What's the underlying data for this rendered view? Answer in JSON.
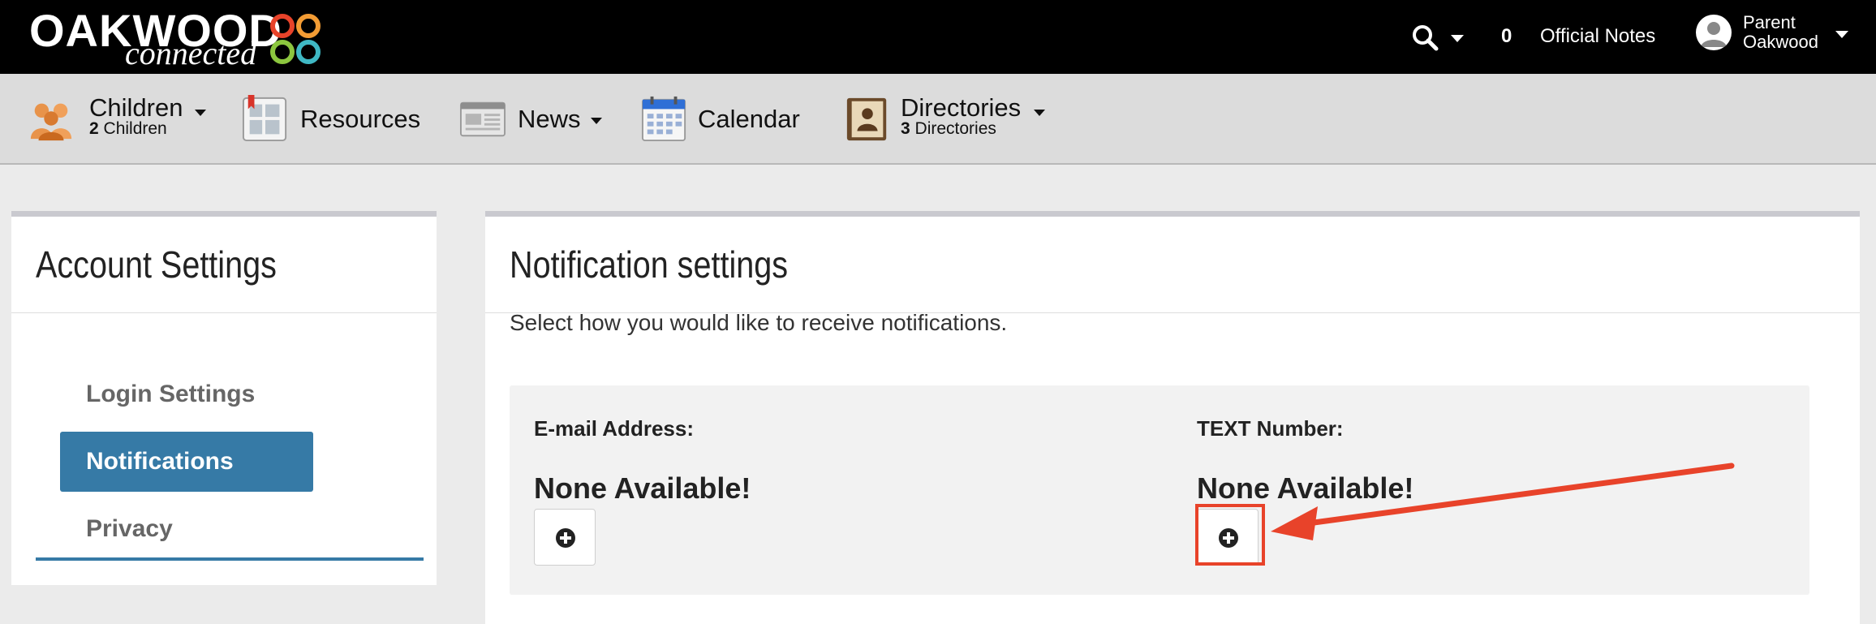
{
  "topbar": {
    "logo_main": "OAKWOOD",
    "logo_sub": "connected",
    "notes_count": "0",
    "notes_label": "Official Notes",
    "user_first": "Parent",
    "user_last": "Oakwood"
  },
  "nav": {
    "children": {
      "label": "Children",
      "count": "2",
      "sub": "Children"
    },
    "resources": {
      "label": "Resources"
    },
    "news": {
      "label": "News"
    },
    "calendar": {
      "label": "Calendar"
    },
    "directories": {
      "label": "Directories",
      "count": "3",
      "sub": "Directories"
    }
  },
  "sidebar": {
    "title": "Account Settings",
    "items": [
      {
        "label": "Login Settings",
        "active": false
      },
      {
        "label": "Notifications",
        "active": true
      },
      {
        "label": "Privacy",
        "active": false
      }
    ]
  },
  "main": {
    "title": "Notification settings",
    "description": "Select how you would like to receive notifications.",
    "email": {
      "label": "E-mail Address:",
      "value": "None Available!"
    },
    "text": {
      "label": "TEXT Number:",
      "value": "None Available!"
    }
  },
  "colors": {
    "accent": "#367aa6",
    "annotation": "#e8432a",
    "topbar": "#000000",
    "navbar": "#dcdcdc"
  },
  "icons": [
    "search-icon",
    "chevron-down-icon",
    "user-avatar-icon",
    "children-icon",
    "resources-icon",
    "news-icon",
    "calendar-icon",
    "directory-book-icon",
    "plus-circle-icon"
  ]
}
